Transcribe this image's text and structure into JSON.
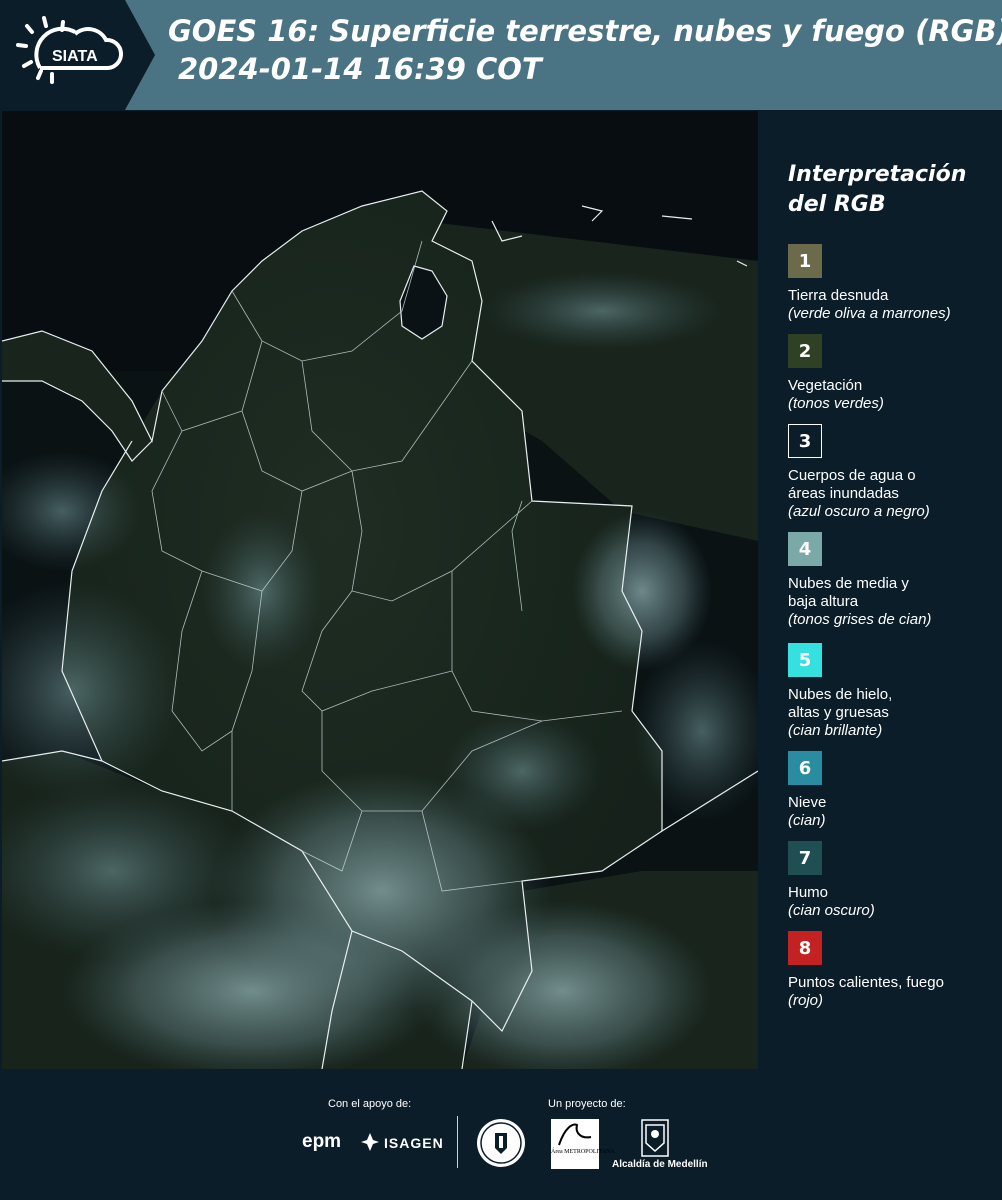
{
  "header": {
    "logo_text": "SIATA",
    "title": "GOES 16: Superficie terrestre, nubes y fuego (RGB)",
    "timestamp": "2024-01-14 16:39 COT"
  },
  "legend": {
    "title_line1": "Interpretación",
    "title_line2": "del RGB",
    "items": [
      {
        "number": "1",
        "label1": "Tierra desnuda",
        "label2": "",
        "note": "(verde oliva a marrones)",
        "color": "#6b6a4b"
      },
      {
        "number": "2",
        "label1": "Vegetación",
        "label2": "",
        "note": "(tonos verdes)",
        "color": "#2f4124"
      },
      {
        "number": "3",
        "label1": "Cuerpos de agua o",
        "label2": "áreas inundadas",
        "note": "(azul oscuro a negro)",
        "color": "#0b1d29"
      },
      {
        "number": "4",
        "label1": "Nubes de media y",
        "label2": "baja altura",
        "note": "(tonos grises de cian)",
        "color": "#7ba9a8"
      },
      {
        "number": "5",
        "label1": "Nubes de hielo,",
        "label2": "altas y gruesas",
        "note": "(cian brillante)",
        "color": "#35e0e0"
      },
      {
        "number": "6",
        "label1": "Nieve",
        "label2": "",
        "note": "(cian)",
        "color": "#2a8ca0"
      },
      {
        "number": "7",
        "label1": "Humo",
        "label2": "",
        "note": "(cian oscuro)",
        "color": "#1f4f52"
      },
      {
        "number": "8",
        "label1": "Puntos calientes, fuego",
        "label2": "",
        "note": "(rojo)",
        "color": "#c42222"
      }
    ]
  },
  "footer": {
    "support_label": "Con el apoyo de:",
    "project_label": "Un proyecto de:",
    "epm_logo": "epm",
    "isagen_logo": "ISAGEN",
    "amva_logo": "Área METROPOLITANA",
    "alcaldia_logo": "Alcaldía de Medellín"
  },
  "colors": {
    "header_bg": "#4a7383",
    "page_bg": "#0b1d29",
    "border_lines": "#ffffff"
  }
}
